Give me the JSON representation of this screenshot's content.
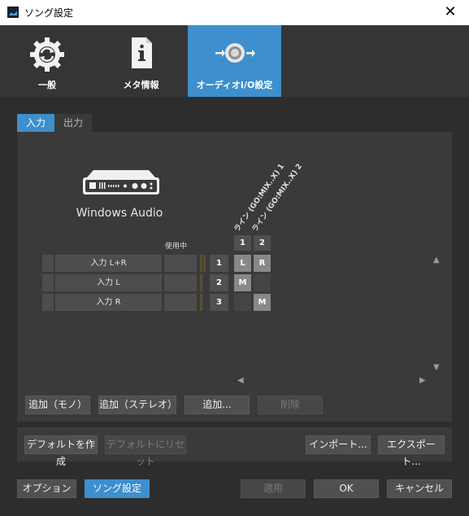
{
  "window": {
    "title": "ソング設定",
    "close_glyph": "✕"
  },
  "topnav": {
    "tabs": [
      {
        "label": "一般",
        "icon": "gear-refresh-icon"
      },
      {
        "label": "メタ情報",
        "icon": "info-document-icon"
      },
      {
        "label": "オーディオI/O設定",
        "icon": "audio-io-icon",
        "active": true
      }
    ]
  },
  "subtabs": {
    "input": "入力",
    "output": "出力"
  },
  "device": {
    "name": "Windows Audio",
    "icon": "audio-interface-icon"
  },
  "matrix": {
    "in_use_label": "使用中",
    "columns": [
      {
        "number": "1",
        "name": "ライン (GO:MIX..X) 1"
      },
      {
        "number": "2",
        "name": "ライン (GO:MIX..X) 2"
      }
    ],
    "rows": [
      {
        "name": "入力 L+R",
        "channel": "1",
        "col1": "L",
        "col2": "R"
      },
      {
        "name": "入力 L",
        "channel": "2",
        "col1": "M",
        "col2": ""
      },
      {
        "name": "入力 R",
        "channel": "3",
        "col1": "",
        "col2": "M"
      }
    ]
  },
  "buttons": {
    "add_mono": "追加（モノ）",
    "add_stereo": "追加（ステレオ）",
    "add": "追加...",
    "delete": "削除",
    "make_default": "デフォルトを作成",
    "reset_default": "デフォルトにリセット",
    "import": "インポート...",
    "export": "エクスポート...",
    "options": "オプション",
    "song_settings": "ソング設定",
    "apply": "適用",
    "ok": "OK",
    "cancel": "キャンセル"
  },
  "colors": {
    "accent": "#3d8fcd",
    "background": "#2d2d2d",
    "panel": "#3a3a3a"
  }
}
